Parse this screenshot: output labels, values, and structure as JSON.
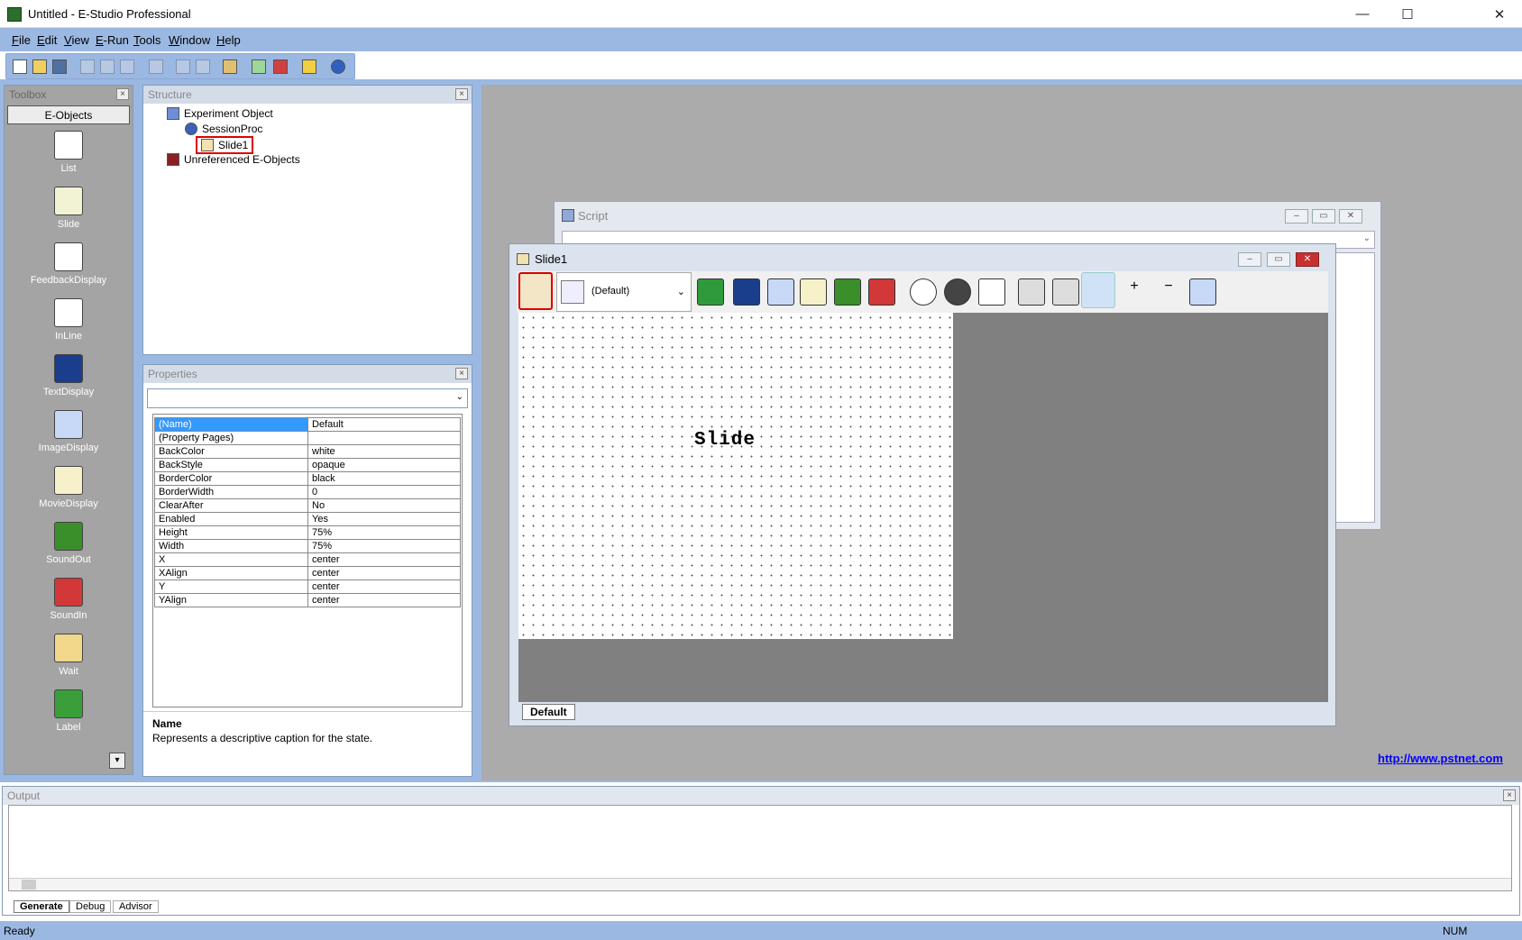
{
  "window": {
    "title": "Untitled - E-Studio Professional",
    "controls": {
      "minimize": "—",
      "maximize": "☐",
      "close": "✕"
    }
  },
  "menu": [
    "File",
    "Edit",
    "View",
    "E-Run",
    "Tools",
    "Window",
    "Help"
  ],
  "toolbar": {
    "buttons": [
      "new",
      "open",
      "save",
      "cut",
      "copy",
      "paste",
      "delete",
      "undo",
      "redo",
      "properties-pages",
      "attribute-structure",
      "run",
      "generate-run",
      "about"
    ]
  },
  "toolbox": {
    "title": "Toolbox",
    "tab": "E-Objects",
    "items": [
      {
        "label": "List",
        "icon": "list-icon",
        "color": "#ffffff"
      },
      {
        "label": "Slide",
        "icon": "slide-icon",
        "color": "#f2f2d4"
      },
      {
        "label": "FeedbackDisplay",
        "icon": "feedback-icon",
        "color": "#ffffff"
      },
      {
        "label": "InLine",
        "icon": "inline-icon",
        "color": "#ffffff"
      },
      {
        "label": "TextDisplay",
        "icon": "textdisplay-icon",
        "color": "#1a3e8c"
      },
      {
        "label": "ImageDisplay",
        "icon": "imagedisplay-icon",
        "color": "#c7d9f7"
      },
      {
        "label": "MovieDisplay",
        "icon": "moviedisplay-icon",
        "color": "#f6f1c8"
      },
      {
        "label": "SoundOut",
        "icon": "soundout-icon",
        "color": "#3a8f2a"
      },
      {
        "label": "SoundIn",
        "icon": "soundin-icon",
        "color": "#d23838"
      },
      {
        "label": "Wait",
        "icon": "wait-icon",
        "color": "#f1d88a"
      },
      {
        "label": "Label",
        "icon": "label-icon",
        "color": "#3a9f3a"
      }
    ]
  },
  "structure": {
    "title": "Structure",
    "nodes": {
      "root": "Experiment Object",
      "session": "SessionProc",
      "slide": "Slide1",
      "unref": "Unreferenced E-Objects"
    }
  },
  "properties": {
    "title": "Properties",
    "rows": [
      {
        "key": "(Name)",
        "value": "Default"
      },
      {
        "key": "(Property Pages)",
        "value": ""
      },
      {
        "key": "BackColor",
        "value": "white"
      },
      {
        "key": "BackStyle",
        "value": "opaque"
      },
      {
        "key": "BorderColor",
        "value": "black"
      },
      {
        "key": "BorderWidth",
        "value": "0"
      },
      {
        "key": "ClearAfter",
        "value": "No"
      },
      {
        "key": "Enabled",
        "value": "Yes"
      },
      {
        "key": "Height",
        "value": "75%"
      },
      {
        "key": "Width",
        "value": "75%"
      },
      {
        "key": "X",
        "value": "center"
      },
      {
        "key": "XAlign",
        "value": "center"
      },
      {
        "key": "Y",
        "value": "center"
      },
      {
        "key": "YAlign",
        "value": "center"
      }
    ],
    "desc_title": "Name",
    "desc_text": "Represents a descriptive caption for the state."
  },
  "script_window": {
    "title": "Script"
  },
  "slide_window": {
    "title": "Slide1",
    "state_select": "(Default)",
    "canvas_text": "Slide",
    "tab": "Default"
  },
  "link": "http://www.pstnet.com",
  "output": {
    "title": "Output",
    "tabs": [
      "Generate",
      "Debug",
      "Advisor"
    ]
  },
  "status": {
    "text": "Ready",
    "num": "NUM"
  }
}
